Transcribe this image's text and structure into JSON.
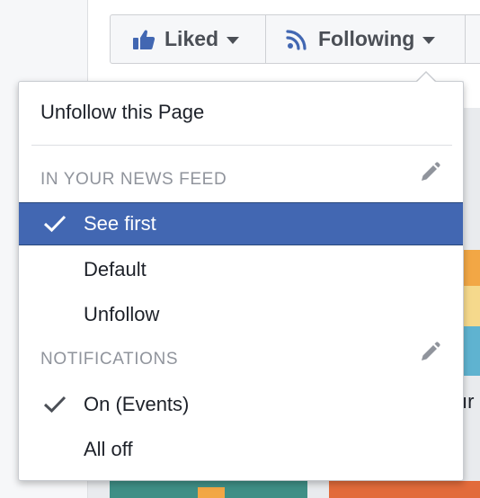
{
  "buttons": {
    "liked_label": "Liked",
    "following_label": "Following"
  },
  "menu": {
    "unfollow_page_label": "Unfollow this Page",
    "news_feed": {
      "title": "IN YOUR NEWS FEED",
      "items": [
        {
          "label": "See first",
          "checked": true,
          "selected": true
        },
        {
          "label": "Default",
          "checked": false
        },
        {
          "label": "Unfollow",
          "checked": false
        }
      ]
    },
    "notifications": {
      "title": "NOTIFICATIONS",
      "items": [
        {
          "label": "On (Events)",
          "checked": true
        },
        {
          "label": "All off",
          "checked": false
        }
      ]
    }
  },
  "background": {
    "partial_text": "ır"
  },
  "colors": {
    "selected_bg": "#4267b2",
    "like_icon": "#4267b2",
    "section_title": "#90949c"
  }
}
